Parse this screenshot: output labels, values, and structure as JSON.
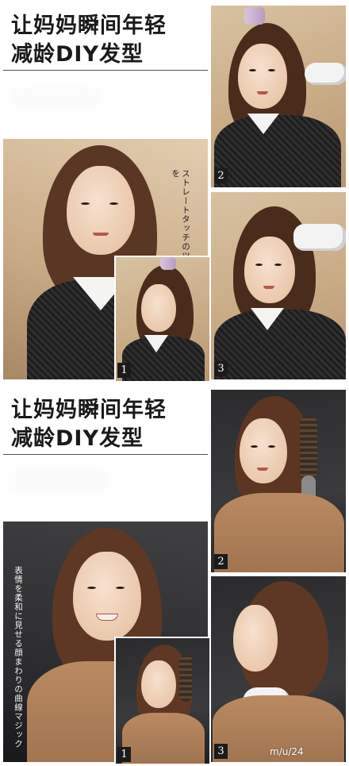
{
  "section1": {
    "title_line1": "让妈妈瞬间年轻",
    "title_line2": "减龄DIY发型",
    "caption": "ストレートタッチのツヤ髪で知的さと清潔感を",
    "step_numbers": [
      "2",
      "1",
      "3"
    ]
  },
  "section2": {
    "title_line1": "让妈妈瞬间年轻",
    "title_line2": "减龄DIY发型",
    "caption": "表情を柔和に見せる顔まわりの曲線マジック",
    "step_numbers": [
      "2",
      "1",
      "3"
    ]
  },
  "watermark": "m/u/24"
}
